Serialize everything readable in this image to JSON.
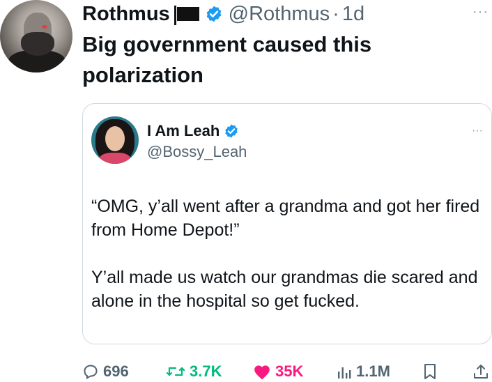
{
  "tweet": {
    "author_name": "Rothmus",
    "handle": "@Rothmus",
    "separator": "·",
    "time": "1d",
    "text": "Big government caused this polarization",
    "more": "···"
  },
  "quote": {
    "author_name": "I Am Leah",
    "handle": "@Bossy_Leah",
    "more": "···",
    "paragraph1": "“OMG, y’all went after a grandma and got her fired from Home Depot!”",
    "paragraph2": "Y’all made us watch our grandmas die scared and alone in the hospital so get fucked."
  },
  "actions": {
    "replies": "696",
    "retweets": "3.7K",
    "likes": "35K",
    "views": "1.1M"
  },
  "colors": {
    "verified": "#1d9bf0",
    "retweet": "#00ba7c",
    "like": "#f91880",
    "muted": "#536471"
  }
}
